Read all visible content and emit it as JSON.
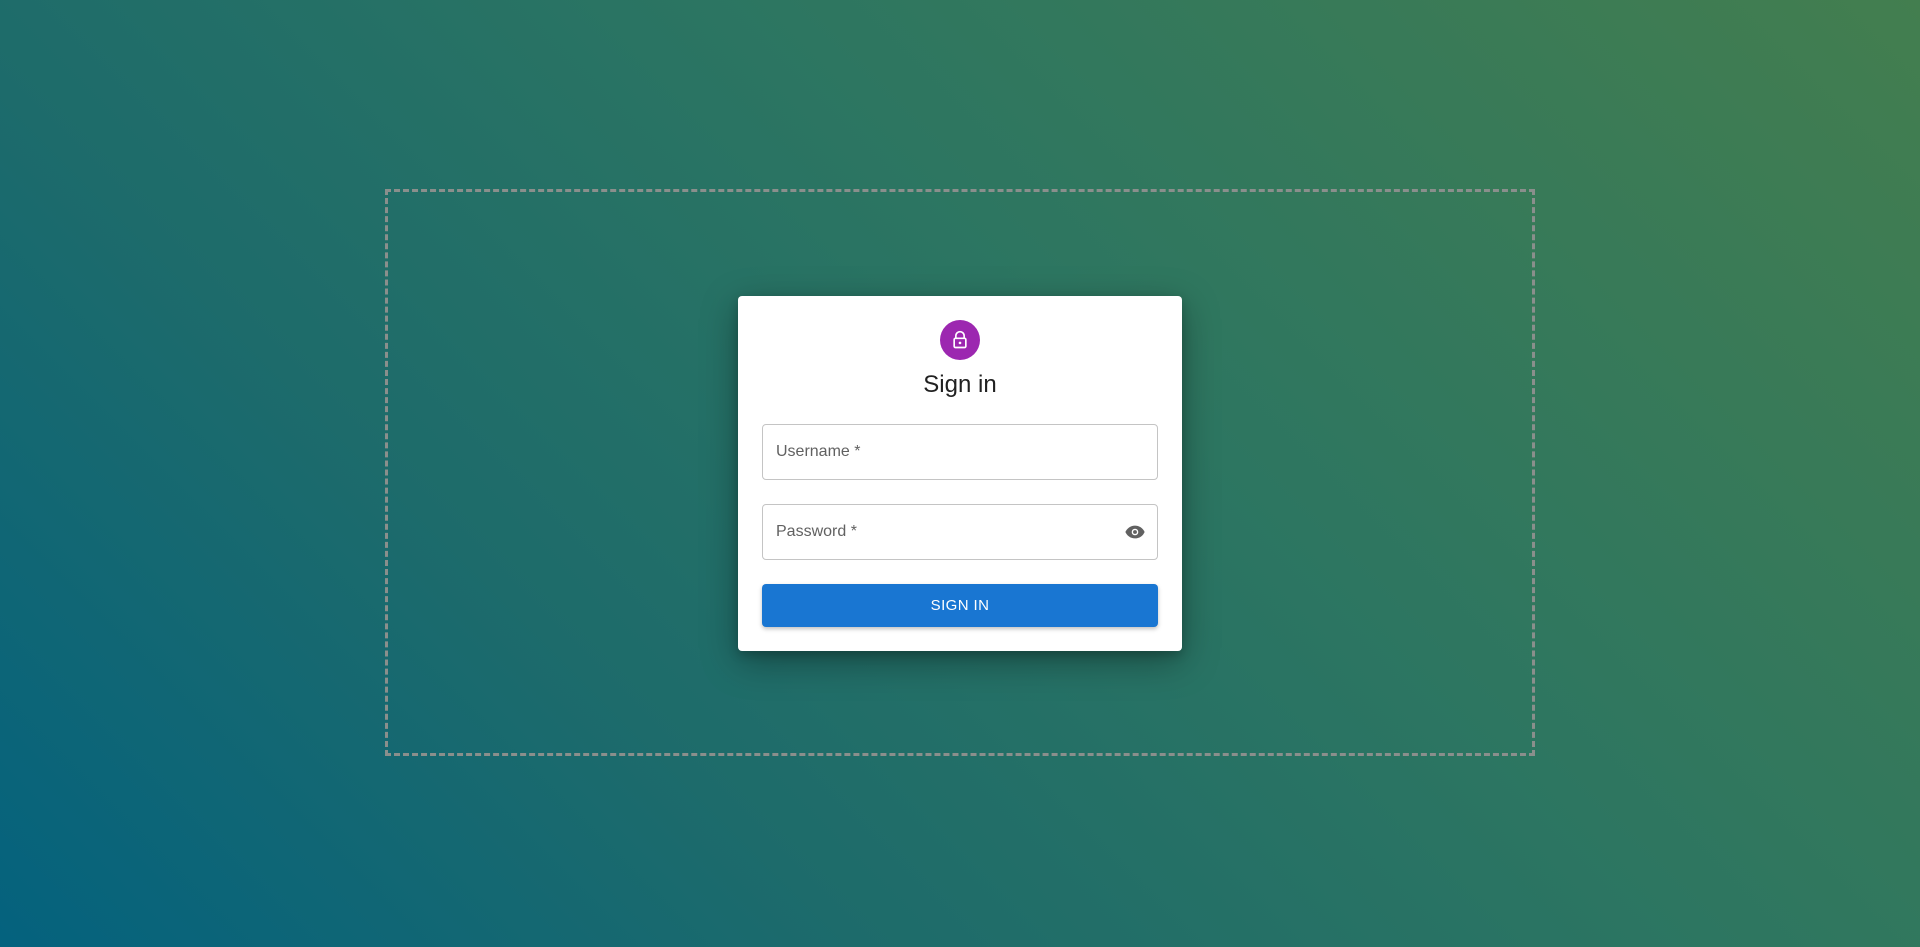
{
  "login": {
    "title": "Sign in",
    "username_label": "Username *",
    "password_label": "Password *",
    "submit_label": "SIGN IN"
  },
  "icons": {
    "avatar": "lock-icon",
    "password_toggle": "eye-icon"
  },
  "colors": {
    "avatar_bg": "#9c27b0",
    "primary": "#1976d2",
    "background_start": "#437e4f",
    "background_end": "#04627e"
  }
}
